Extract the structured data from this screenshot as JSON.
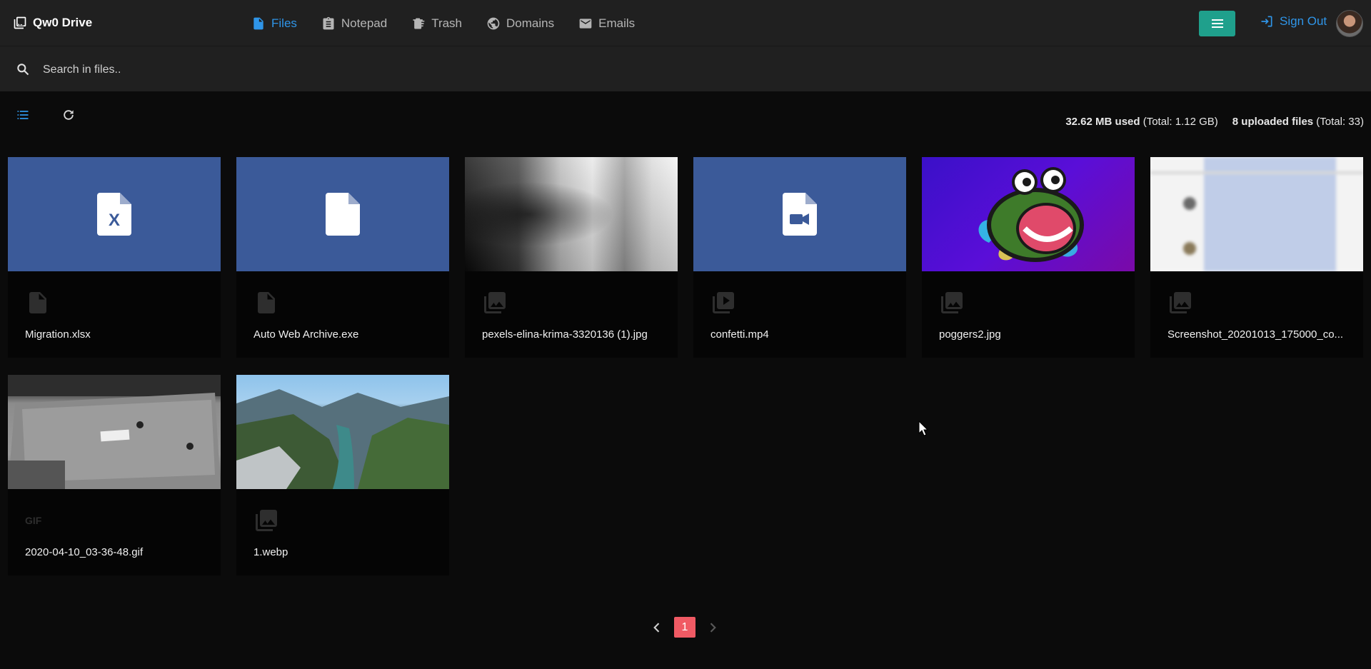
{
  "app": {
    "title": "Qw0 Drive"
  },
  "nav": {
    "items": [
      {
        "label": "Files",
        "icon": "file-icon"
      },
      {
        "label": "Notepad",
        "icon": "clipboard-icon"
      },
      {
        "label": "Trash",
        "icon": "trash-icon"
      },
      {
        "label": "Domains",
        "icon": "globe-icon"
      },
      {
        "label": "Emails",
        "icon": "mail-icon"
      }
    ],
    "active": "Files"
  },
  "header": {
    "sign_out_label": "Sign Out"
  },
  "search": {
    "placeholder": "Search in files.."
  },
  "stats": {
    "used": "32.62 MB used",
    "used_total": "(Total: 1.12 GB)",
    "uploaded": "8 uploaded files",
    "uploaded_total": "(Total: 33)"
  },
  "files": [
    {
      "name": "Migration.xlsx",
      "type_icon": "document-icon",
      "thumb": "excel-icon"
    },
    {
      "name": "Auto Web Archive.exe",
      "type_icon": "document-icon",
      "thumb": "file-icon"
    },
    {
      "name": "pexels-elina-krima-3320136 (1).jpg",
      "type_icon": "image-icon",
      "thumb": "photo"
    },
    {
      "name": "confetti.mp4",
      "type_icon": "video-icon",
      "thumb": "video-file-icon"
    },
    {
      "name": "poggers2.jpg",
      "type_icon": "image-icon",
      "thumb": "photo"
    },
    {
      "name": "Screenshot_20201013_175000_co...",
      "type_icon": "image-icon",
      "thumb": "photo"
    },
    {
      "name": "2020-04-10_03-36-48.gif",
      "type_icon": "gif-icon",
      "type_text": "GIF",
      "thumb": "photo"
    },
    {
      "name": "1.webp",
      "type_icon": "image-icon",
      "thumb": "photo"
    }
  ],
  "pagination": {
    "current": "1"
  },
  "colors": {
    "accent": "#2f95e8",
    "menu_button": "#1fa08c",
    "card_thumb": "#3b5a99",
    "page_active": "#f05a64"
  }
}
